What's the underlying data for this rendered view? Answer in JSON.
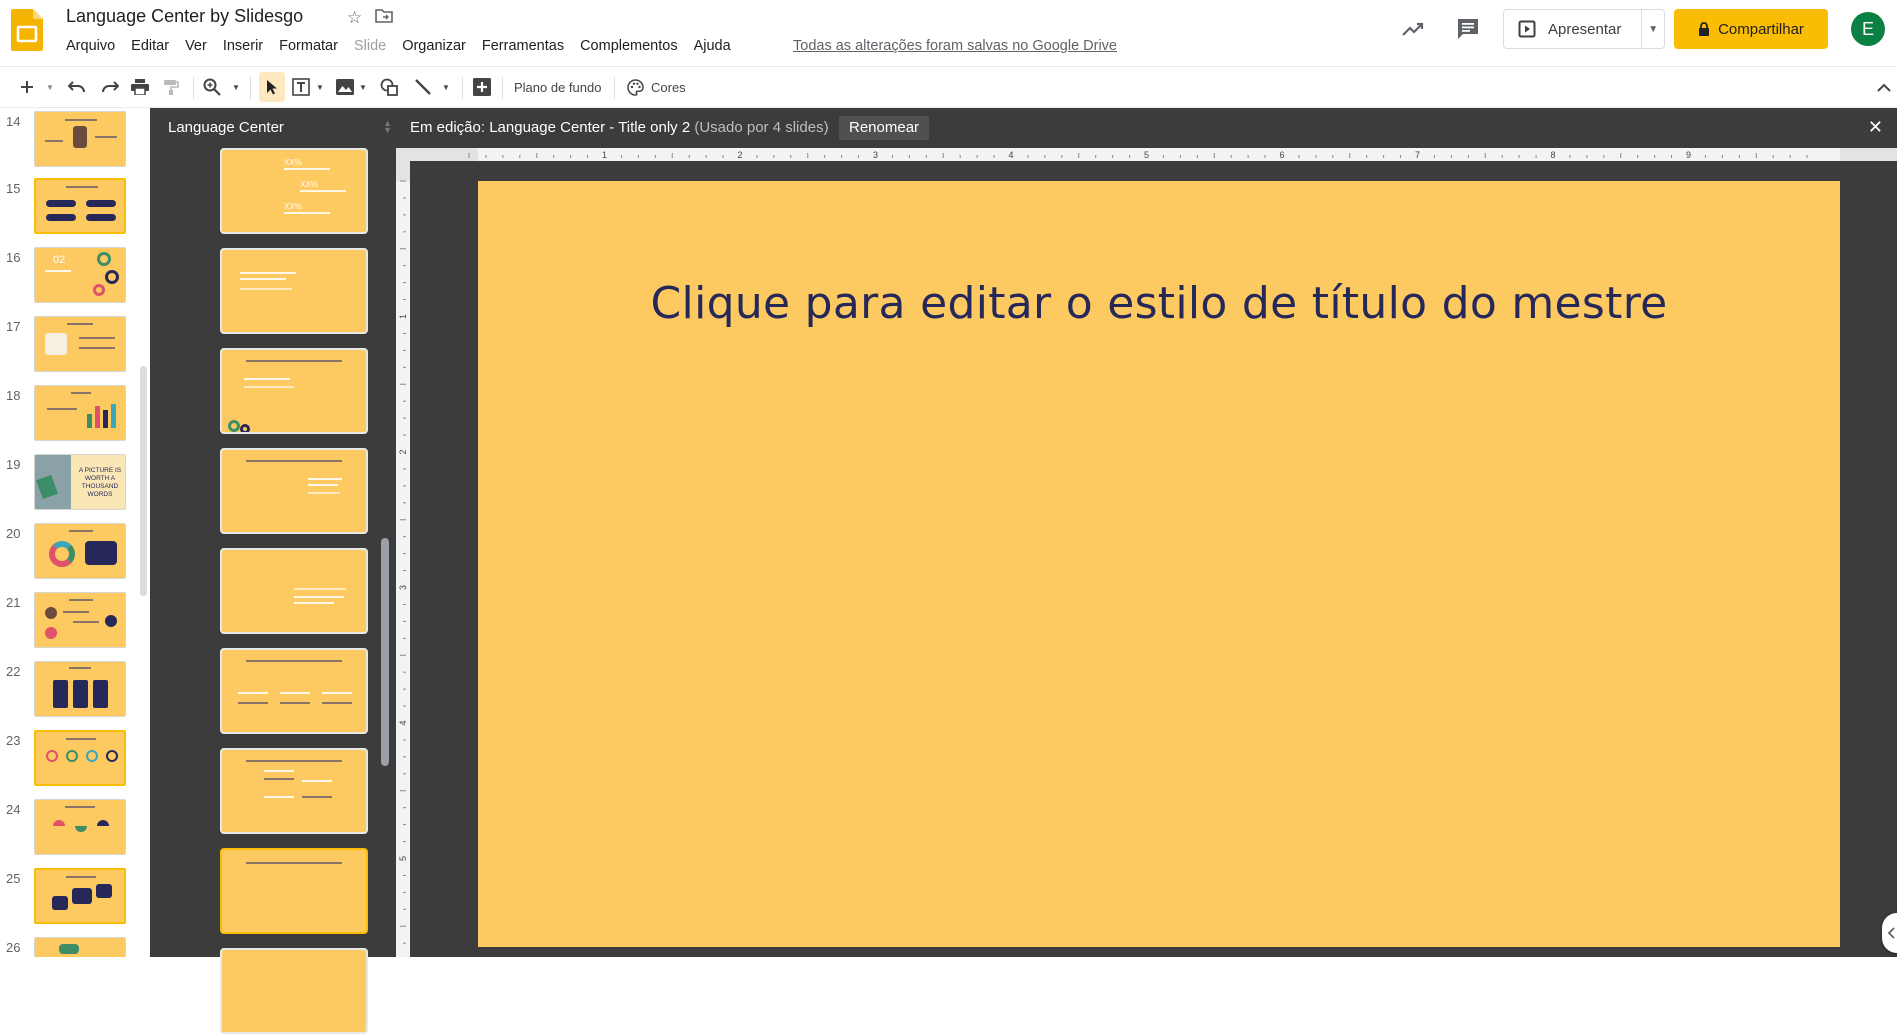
{
  "app": {
    "doc_title": "Language Center by Slidesgo",
    "menu": [
      "Arquivo",
      "Editar",
      "Ver",
      "Inserir",
      "Formatar",
      "Slide",
      "Organizar",
      "Ferramentas",
      "Complementos",
      "Ajuda"
    ],
    "saved_status": "Todas as alterações foram salvas no Google Drive",
    "present_label": "Apresentar",
    "share_label": "Compartilhar",
    "avatar_letter": "E"
  },
  "toolbar": {
    "background_label": "Plano de fundo",
    "colors_label": "Cores"
  },
  "filmstrip": {
    "numbers": [
      "14",
      "15",
      "16",
      "17",
      "18",
      "19",
      "20",
      "21",
      "22",
      "23",
      "24",
      "25",
      "26"
    ],
    "slide19_text": "A PICTURE IS WORTH A THOUSAND WORDS",
    "slide16_text": "02"
  },
  "layouts_panel": {
    "title": "Language Center",
    "thumb_percent": "XX%"
  },
  "edit_bar": {
    "prefix": "Em edição: Language Center - Title only 2",
    "usage": "(Usado por 4 slides)",
    "rename_label": "Renomear"
  },
  "ruler": {
    "top_marks": [
      "1",
      "2",
      "3",
      "4",
      "5",
      "6",
      "7",
      "8",
      "9"
    ],
    "left_marks": [
      "1",
      "2",
      "3",
      "4",
      "5"
    ]
  },
  "slide": {
    "title": "Clique para editar o estilo de título do mestre",
    "background": "#fdc961",
    "title_color": "#27285a"
  },
  "colors": {
    "accent": "#fbbc04",
    "dark_panel": "#3c3c3c",
    "avatar": "#0b8043"
  }
}
